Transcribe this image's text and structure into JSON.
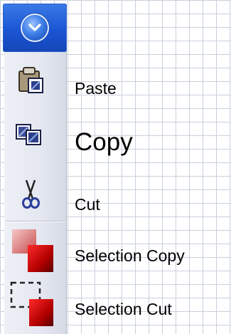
{
  "toolbar": {
    "dropdown_icon": "chevron-down-circle-icon",
    "accent_color": "#1b55d4",
    "items": [
      {
        "label": "Paste",
        "icon": "paste-icon"
      },
      {
        "label": "Copy",
        "icon": "copy-icon"
      },
      {
        "label": "Cut",
        "icon": "scissors-icon"
      },
      {
        "label": "Selection Copy",
        "icon": "selection-copy-icon"
      },
      {
        "label": "Selection Cut",
        "icon": "selection-cut-icon"
      }
    ]
  }
}
